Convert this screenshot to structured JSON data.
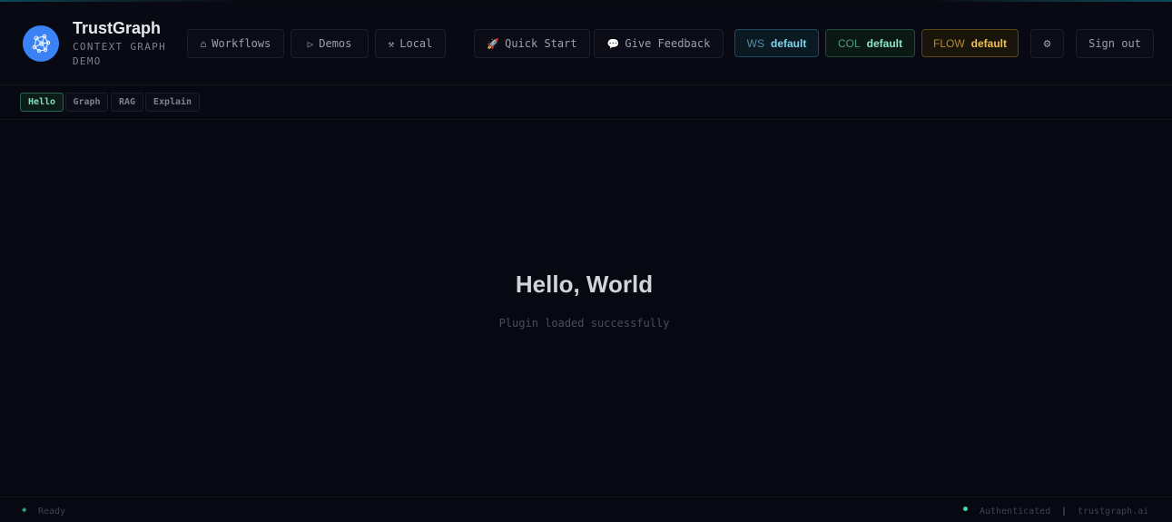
{
  "app": {
    "title": "TrustGraph",
    "subtitle": "CONTEXT GRAPH DEMO"
  },
  "nav": [
    {
      "label": "Workflows",
      "icon": "home-icon",
      "glyph": "⌂"
    },
    {
      "label": "Demos",
      "icon": "play-icon",
      "glyph": "▷"
    },
    {
      "label": "Local",
      "icon": "tools-icon",
      "glyph": "⚒"
    }
  ],
  "actions": {
    "quick_start": {
      "label": "Quick Start",
      "icon": "rocket-icon",
      "glyph": "🚀"
    },
    "feedback": {
      "label": "Give Feedback",
      "icon": "speech-bubble-icon",
      "glyph": "💬"
    }
  },
  "context": {
    "ws": {
      "key": "WS",
      "value": "default"
    },
    "col": {
      "key": "COL",
      "value": "default"
    },
    "flow": {
      "key": "FLOW",
      "value": "default"
    }
  },
  "settings": {
    "icon": "gear-icon",
    "glyph": "⚙"
  },
  "sign_out": "Sign out",
  "tabs": [
    {
      "label": "Hello",
      "active": true
    },
    {
      "label": "Graph",
      "active": false
    },
    {
      "label": "RAG",
      "active": false
    },
    {
      "label": "Explain",
      "active": false
    }
  ],
  "main": {
    "heading": "Hello, World",
    "message": "Plugin loaded successfully"
  },
  "footer": {
    "status_icon": "diamond-icon",
    "status_glyph": "◈",
    "status": "Ready",
    "auth": "Authenticated",
    "separator": "|",
    "site": "trustgraph.ai"
  },
  "colors": {
    "background": "#070811",
    "logo": "#3b82f6",
    "ws_accent": "#7fd6ee",
    "col_accent": "#8ee6c8",
    "flow_accent": "#f0c04a",
    "active_tab": "#7fe0bd"
  }
}
